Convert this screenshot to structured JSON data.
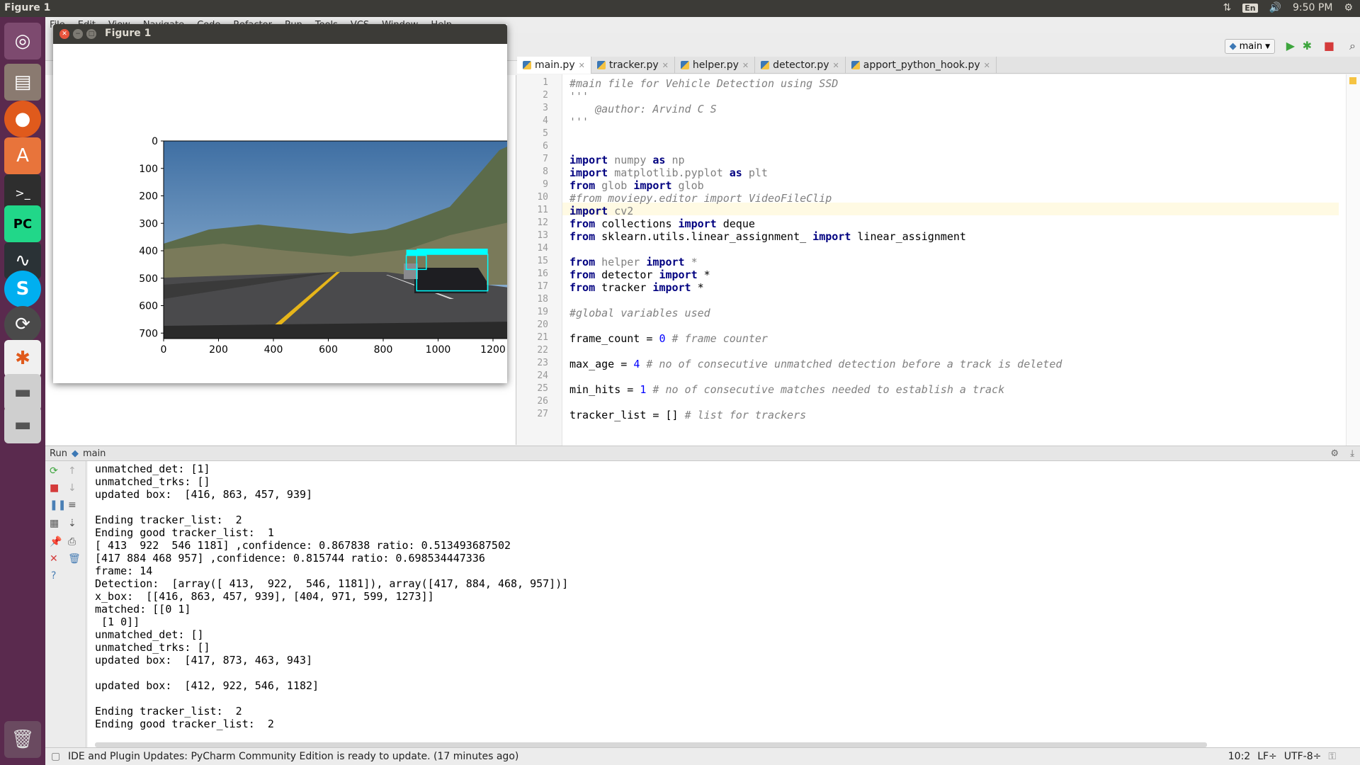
{
  "topbar": {
    "title": "Figure 1",
    "lang": "En",
    "time": "9:50 PM"
  },
  "launcher": {
    "items": [
      "ubuntu-dash",
      "files",
      "firefox",
      "software-center",
      "terminal",
      "pycharm",
      "system-monitor",
      "skype",
      "software-updater",
      "inkscape",
      "disk-drive-1",
      "disk-drive-2",
      "trash"
    ]
  },
  "menubar": {
    "items": [
      "File",
      "Edit",
      "View",
      "Navigate",
      "Code",
      "Refactor",
      "Run",
      "Tools",
      "VCS",
      "Window",
      "Help"
    ]
  },
  "toolbar": {
    "run_config": "main"
  },
  "tabs": [
    {
      "label": "main.py",
      "active": true
    },
    {
      "label": "tracker.py",
      "active": false
    },
    {
      "label": "helper.py",
      "active": false
    },
    {
      "label": "detector.py",
      "active": false
    },
    {
      "label": "apport_python_hook.py",
      "active": false
    }
  ],
  "editor": {
    "lines": [
      {
        "n": "1",
        "html": "<span class=\"cm\">#main file for Vehicle Detection using SSD</span>"
      },
      {
        "n": "2",
        "html": "<span class=\"cm\">'''</span>"
      },
      {
        "n": "3",
        "html": "<span class=\"cm\">    @author: Arvind C S</span>"
      },
      {
        "n": "4",
        "html": "<span class=\"cm\">'''</span>"
      },
      {
        "n": "5",
        "html": ""
      },
      {
        "n": "6",
        "html": ""
      },
      {
        "n": "7",
        "html": "<span class=\"kw\">import</span> <span class=\"dim\">numpy</span> <span class=\"kw\">as</span> <span class=\"dim\">np</span>"
      },
      {
        "n": "8",
        "html": "<span class=\"kw\">import</span> <span class=\"dim\">matplotlib.pyplot</span> <span class=\"kw\">as</span> <span class=\"dim\">plt</span>"
      },
      {
        "n": "9",
        "html": "<span class=\"kw\">from</span> <span class=\"dim\">glob</span> <span class=\"kw\">import</span> <span class=\"dim\">glob</span>"
      },
      {
        "n": "10",
        "html": "<span class=\"cm\">#from moviepy.editor import VideoFileClip</span>"
      },
      {
        "n": "11",
        "html": "<span class=\"kw\">import</span> <span class=\"dim\">cv2</span>"
      },
      {
        "n": "12",
        "html": "<span class=\"kw\">from</span> collections <span class=\"kw\">import</span> deque"
      },
      {
        "n": "13",
        "html": "<span class=\"kw\">from</span> sklearn.utils.linear_assignment_ <span class=\"kw\">import</span> linear_assignment"
      },
      {
        "n": "14",
        "html": ""
      },
      {
        "n": "15",
        "html": "<span class=\"kw\">from</span> <span class=\"dim\">helper</span> <span class=\"kw\">import</span> <span class=\"dim\">*</span>"
      },
      {
        "n": "16",
        "html": "<span class=\"kw\">from</span> detector <span class=\"kw\">import</span> *"
      },
      {
        "n": "17",
        "html": "<span class=\"kw\">from</span> tracker <span class=\"kw\">import</span> *"
      },
      {
        "n": "18",
        "html": ""
      },
      {
        "n": "19",
        "html": "<span class=\"cm\">#global variables used</span>"
      },
      {
        "n": "20",
        "html": ""
      },
      {
        "n": "21",
        "html": "frame_count = <span class=\"nm\">0</span> <span class=\"cm\"># frame counter</span>"
      },
      {
        "n": "22",
        "html": ""
      },
      {
        "n": "23",
        "html": "max_age = <span class=\"nm\">4</span> <span class=\"cm\"># no of consecutive unmatched detection before a track is deleted</span>"
      },
      {
        "n": "24",
        "html": ""
      },
      {
        "n": "25",
        "html": "min_hits = <span class=\"nm\">1</span> <span class=\"cm\"># no of consecutive matches needed to establish a track</span>"
      },
      {
        "n": "26",
        "html": ""
      },
      {
        "n": "27",
        "html": "tracker_list = [] <span class=\"cm\"># list for trackers</span>"
      }
    ]
  },
  "run": {
    "label": "Run",
    "config": "main"
  },
  "console": {
    "lines": [
      "unmatched_det: [1]",
      "unmatched_trks: []",
      "updated box:  [416, 863, 457, 939]",
      "",
      "Ending tracker_list:  2",
      "Ending good tracker_list:  1",
      "[ 413  922  546 1181] ,confidence: 0.867838 ratio: 0.513493687502",
      "[417 884 468 957] ,confidence: 0.815744 ratio: 0.698534447336",
      "frame: 14",
      "Detection:  [array([ 413,  922,  546, 1181]), array([417, 884, 468, 957])]",
      "x_box:  [[416, 863, 457, 939], [404, 971, 599, 1273]]",
      "matched: [[0 1]",
      " [1 0]]",
      "unmatched_det: []",
      "unmatched_trks: []",
      "updated box:  [417, 873, 463, 943]",
      "",
      "updated box:  [412, 922, 546, 1182]",
      "",
      "Ending tracker_list:  2",
      "Ending good tracker_list:  2"
    ]
  },
  "status": {
    "message": "IDE and Plugin Updates: PyCharm Community Edition is ready to update. (17 minutes ago)",
    "position": "10:2",
    "line_sep": "LF÷",
    "encoding": "UTF-8÷"
  },
  "figure": {
    "title": "Figure 1",
    "xticks": [
      "0",
      "200",
      "400",
      "600",
      "800",
      "1000",
      "1200"
    ],
    "yticks": [
      "0",
      "100",
      "200",
      "300",
      "400",
      "500",
      "600",
      "700"
    ],
    "boxes": [
      {
        "label": "car",
        "x1": 922,
        "y1": 413,
        "x2": 1181,
        "y2": 546
      },
      {
        "label": "car",
        "x1": 884,
        "y1": 417,
        "x2": 957,
        "y2": 468
      }
    ]
  }
}
